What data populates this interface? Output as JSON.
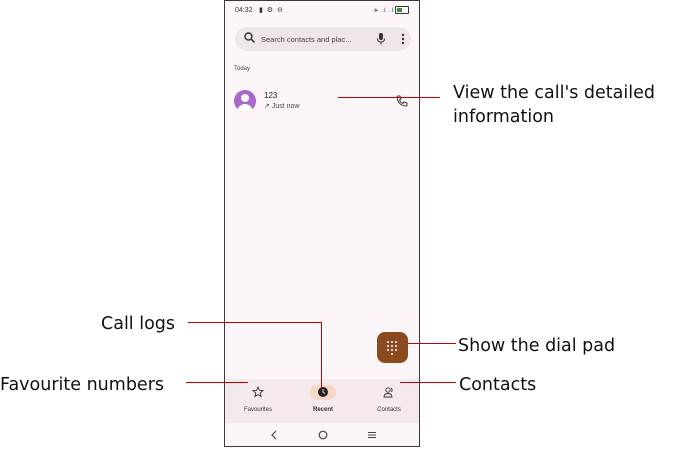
{
  "status_bar": {
    "time": "04:32"
  },
  "search": {
    "placeholder": "Search contacts and plac..."
  },
  "recent": {
    "section_label": "Today",
    "calls": [
      {
        "number": "123",
        "time": "Just now"
      }
    ]
  },
  "nav": {
    "tabs": [
      {
        "label": "Favourites",
        "icon": "star-icon"
      },
      {
        "label": "Recent",
        "icon": "clock-icon",
        "active": true
      },
      {
        "label": "Contacts",
        "icon": "contacts-icon"
      }
    ]
  },
  "annotations": {
    "details": "View the call's detailed information",
    "call_logs": "Call logs",
    "favourites": "Favourite numbers",
    "dial_pad": "Show the dial pad",
    "contacts": "Contacts"
  },
  "colors": {
    "accent_fab": "#8a4a1f",
    "avatar": "#a967cc",
    "active_tab": "#f5d7c6",
    "annotation_line": "#c00000"
  }
}
